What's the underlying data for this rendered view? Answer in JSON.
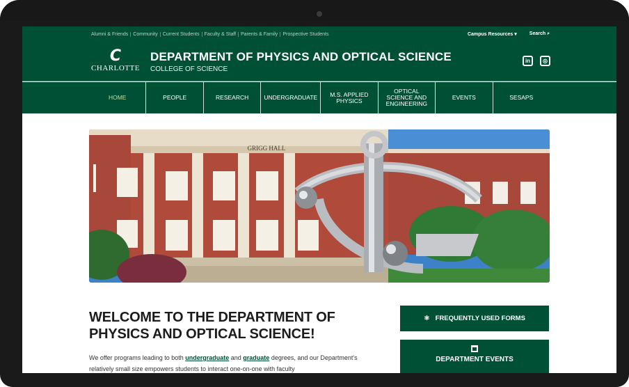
{
  "utility_bar": {
    "audience_links": [
      "Alumni & Friends",
      "Community",
      "Current Students",
      "Faculty & Staff",
      "Parents & Family",
      "Prospective Students"
    ],
    "campus_resources": "Campus Resources ▾",
    "search": "Search ⌕"
  },
  "brand": {
    "logo_mark": "C",
    "logo_word": "CHARLOTTE",
    "title": "DEPARTMENT OF PHYSICS AND OPTICAL SCIENCE",
    "college": "COLLEGE OF SCIENCE",
    "social": [
      "in",
      "◎"
    ]
  },
  "nav": {
    "items": [
      "HOME",
      "PEOPLE",
      "RESEARCH",
      "UNDERGRADUATE",
      "M.S. APPLIED PHYSICS",
      "OPTICAL SCIENCE AND ENGINEERING",
      "EVENTS",
      "SESAPS"
    ],
    "active": "HOME"
  },
  "hero": {
    "building_sign": "GRIGG HALL"
  },
  "welcome": {
    "title": "WELCOME TO THE DEPARTMENT OF PHYSICS AND OPTICAL SCIENCE!",
    "text_1": "We offer programs leading to both ",
    "link_undergraduate": "undergraduate",
    "text_2": " and ",
    "link_graduate": "graduate",
    "text_3": " degrees, and our Department's relatively small size empowers students to interact one-on-one with faculty"
  },
  "sidebar_buttons": {
    "forms": "FREQUENTLY USED FORMS",
    "events": "DEPARTMENT EVENTS"
  },
  "colors": {
    "brand_green": "#005035",
    "active_nav": "#c8dca0"
  }
}
